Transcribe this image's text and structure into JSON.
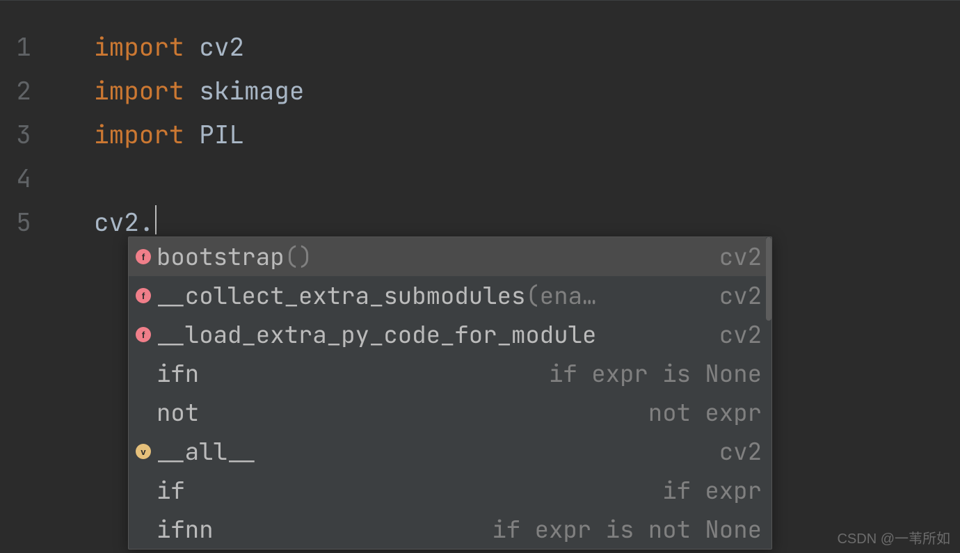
{
  "gutter": [
    "1",
    "2",
    "3",
    "4",
    "5"
  ],
  "code": {
    "kwd_import": "import",
    "mod_cv2": "cv2",
    "mod_skimage": "skimage",
    "mod_pil": "PIL",
    "line5_obj": "cv2",
    "line5_dot": "."
  },
  "autocomplete": {
    "items": [
      {
        "icon": "f",
        "iconClass": "func",
        "label": "bootstrap",
        "params": "()",
        "right": "cv2"
      },
      {
        "icon": "f",
        "iconClass": "func",
        "label": "__collect_extra_submodules",
        "params": "(ena…",
        "right": "cv2"
      },
      {
        "icon": "f",
        "iconClass": "func",
        "label": "__load_extra_py_code_for_module",
        "params": "",
        "right": "cv2"
      },
      {
        "icon": "",
        "iconClass": "none",
        "label": "ifn",
        "params": "",
        "right": "if expr is None"
      },
      {
        "icon": "",
        "iconClass": "none",
        "label": "not",
        "params": "",
        "right": "not expr"
      },
      {
        "icon": "v",
        "iconClass": "var",
        "label": "__all__",
        "params": "",
        "right": "cv2"
      },
      {
        "icon": "",
        "iconClass": "none",
        "label": "if",
        "params": "",
        "right": "if expr"
      },
      {
        "icon": "",
        "iconClass": "none",
        "label": "ifnn",
        "params": "",
        "right": "if expr is not None"
      }
    ]
  },
  "watermark": "CSDN @一苇所如"
}
